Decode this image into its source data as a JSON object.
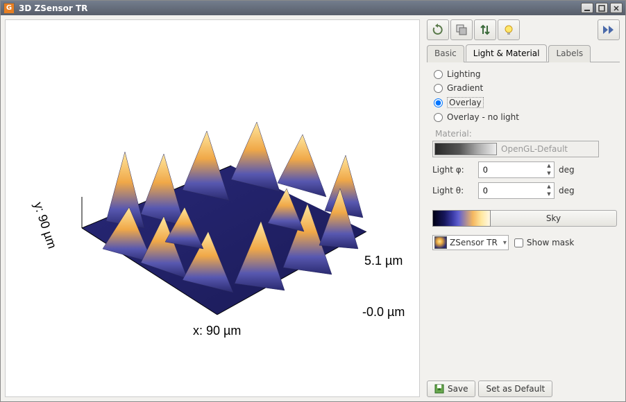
{
  "window": {
    "title": "3D ZSensor TR"
  },
  "viewport": {
    "axis_x": "x: 90 µm",
    "axis_y": "y: 90 µm",
    "z_max": "5.1 µm",
    "z_min": "-0.0 µm"
  },
  "tabs": {
    "basic": "Basic",
    "lightmat": "Light & Material",
    "labels": "Labels"
  },
  "panel": {
    "radios": {
      "lighting": "Lighting",
      "gradient": "Gradient",
      "overlay": "Overlay",
      "overlay_nolight": "Overlay - no light"
    },
    "material_label": "Material:",
    "material_name": "OpenGL-Default",
    "light_phi_label": "Light φ:",
    "light_phi_value": "0",
    "light_theta_label": "Light θ:",
    "light_theta_value": "0",
    "deg": "deg",
    "colormap_button": "Sky",
    "datasource": "ZSensor TR",
    "show_mask": "Show mask"
  },
  "buttons": {
    "save": "Save",
    "set_default": "Set as Default"
  }
}
